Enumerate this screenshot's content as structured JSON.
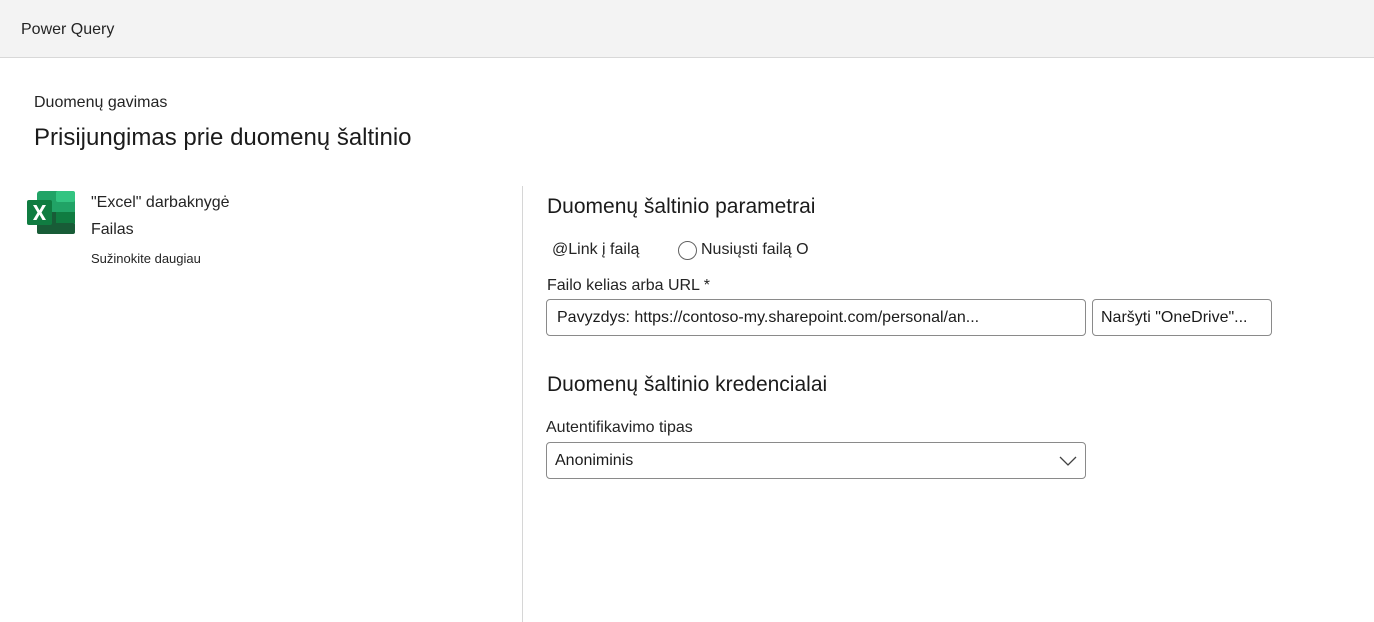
{
  "app": {
    "title": "Power Query"
  },
  "header": {
    "breadcrumb": "Duomenų gavimas",
    "title": "Prisijungimas prie duomenų šaltinio"
  },
  "connector": {
    "icon": "excel-icon",
    "name": "\"Excel\" darbaknygė",
    "category": "Failas",
    "learn_more": "Sužinokite daugiau"
  },
  "parameters": {
    "section_title": "Duomenų šaltinio parametrai",
    "radio_link_label": "@Link į failą",
    "radio_upload_label": "Nusiųsti failą O",
    "path_label": "Failo kelias arba URL *",
    "path_placeholder": "Pavyzdys: https://contoso-my.sharepoint.com/personal/an...",
    "path_value": "",
    "browse_label": "Naršyti \"OneDrive\"..."
  },
  "credentials": {
    "section_title": "Duomenų šaltinio kredencialai",
    "auth_label": "Autentifikavimo tipas",
    "auth_value": "Anoniminis"
  },
  "colors": {
    "topbar": "#f3f3f3",
    "excel_green_dark": "#185c37",
    "excel_green": "#21a366",
    "excel_green_light": "#33c481",
    "border": "#8a8a8a"
  }
}
